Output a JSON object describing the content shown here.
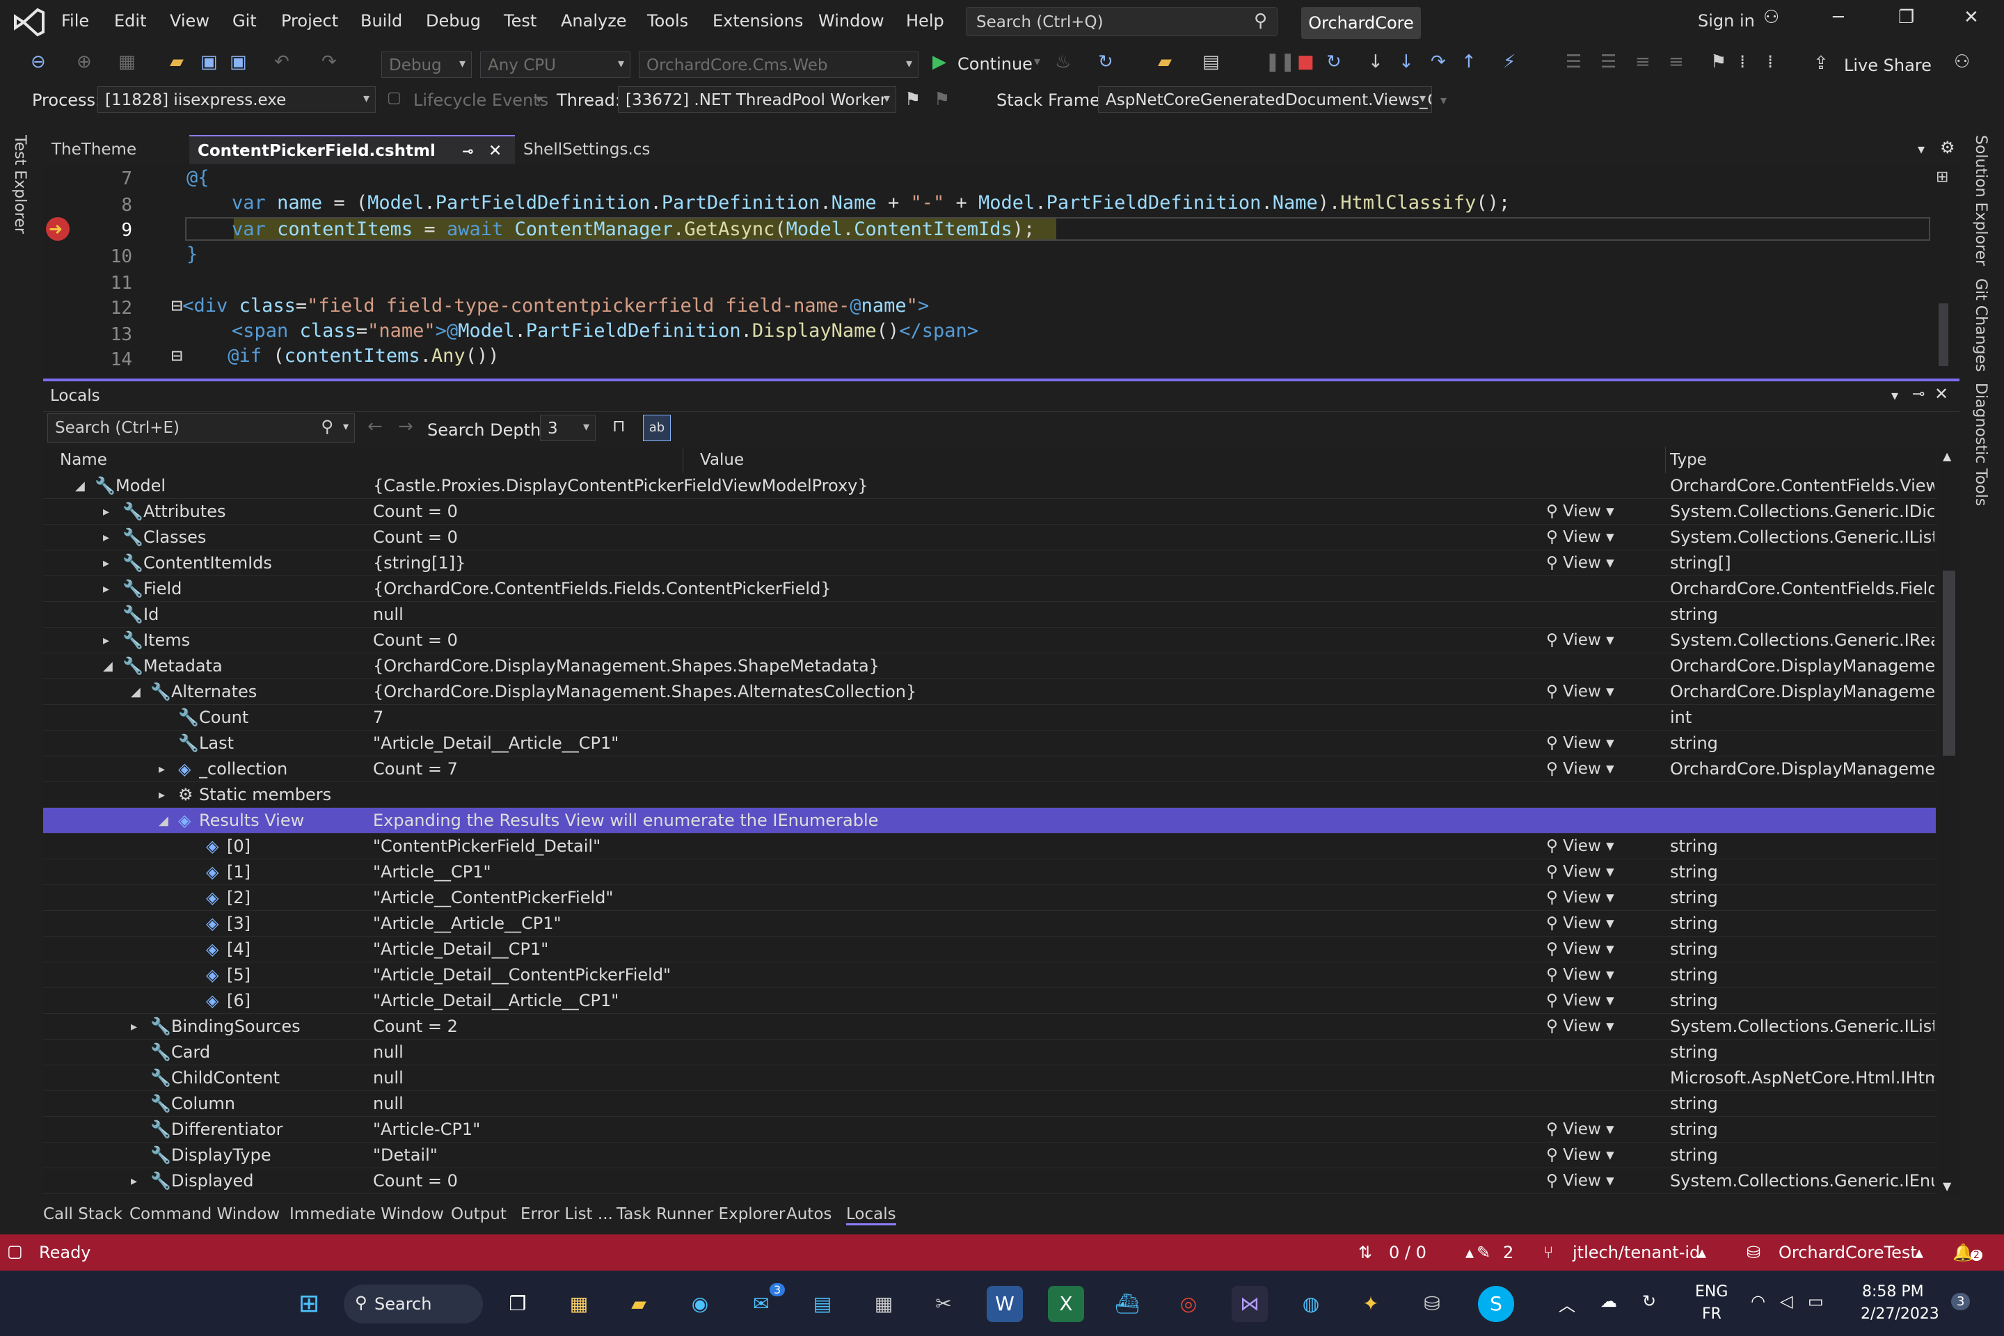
{
  "menu": {
    "items": [
      "File",
      "Edit",
      "View",
      "Git",
      "Project",
      "Build",
      "Debug",
      "Test",
      "Analyze",
      "Tools",
      "Extensions",
      "Window",
      "Help"
    ],
    "search_placeholder": "Search (Ctrl+Q)",
    "solution": "OrchardCore",
    "signin": "Sign in"
  },
  "toolbar": {
    "config": "Debug",
    "platform": "Any CPU",
    "startup": "OrchardCore.Cms.Web",
    "continue": "Continue",
    "live_share": "Live Share"
  },
  "debugbar": {
    "process_label": "Process:",
    "process": "[11828] iisexpress.exe",
    "lifecycle": "Lifecycle Events",
    "thread_label": "Thread:",
    "thread": "[33672] .NET ThreadPool Worker",
    "stackframe_label": "Stack Frame:",
    "stackframe": "AspNetCoreGeneratedDocument.Views_C"
  },
  "side": {
    "left": "Test Explorer",
    "right1": "Solution Explorer",
    "right2": "Git Changes",
    "right3": "Diagnostic Tools"
  },
  "tabs": [
    "TheTheme",
    "ContentPickerField.cshtml",
    "ShellSettings.cs"
  ],
  "editor": {
    "lines": [
      "7",
      "8",
      "9",
      "10",
      "11",
      "12",
      "13",
      "14"
    ]
  },
  "locals": {
    "title": "Locals",
    "search": "Search (Ctrl+E)",
    "depth_label": "Search Depth:",
    "depth": "3",
    "col_name": "Name",
    "col_value": "Value",
    "col_type": "Type",
    "view": "View",
    "rows": [
      {
        "name": "Model",
        "value": "{Castle.Proxies.DisplayContentPickerFieldViewModelProxy}",
        "type": "OrchardCore.ContentFields.ViewMod..."
      },
      {
        "name": "Attributes",
        "value": "Count = 0",
        "type": "System.Collections.Generic.IDictionar..."
      },
      {
        "name": "Classes",
        "value": "Count = 0",
        "type": "System.Collections.Generic.IList<strin..."
      },
      {
        "name": "ContentItemIds",
        "value": "{string[1]}",
        "type": "string[]"
      },
      {
        "name": "Field",
        "value": "{OrchardCore.ContentFields.Fields.ContentPickerField}",
        "type": "OrchardCore.ContentFields.Fields.Co..."
      },
      {
        "name": "Id",
        "value": "null",
        "type": "string"
      },
      {
        "name": "Items",
        "value": "Count = 0",
        "type": "System.Collections.Generic.IReadOnl..."
      },
      {
        "name": "Metadata",
        "value": "{OrchardCore.DisplayManagement.Shapes.ShapeMetadata}",
        "type": "OrchardCore.DisplayManagement.Sh..."
      },
      {
        "name": "Alternates",
        "value": "{OrchardCore.DisplayManagement.Shapes.AlternatesCollection}",
        "type": "OrchardCore.DisplayManagement.Sh..."
      },
      {
        "name": "Count",
        "value": "7",
        "type": "int"
      },
      {
        "name": "Last",
        "value": "\"Article_Detail__Article__CP1\"",
        "type": "string"
      },
      {
        "name": "_collection",
        "value": "Count = 7",
        "type": "OrchardCore.DisplayManagement.Sh..."
      },
      {
        "name": "Static members",
        "value": "",
        "type": ""
      },
      {
        "name": "Results View",
        "value": "Expanding the Results View will enumerate the IEnumerable",
        "type": ""
      },
      {
        "name": "[0]",
        "value": "\"ContentPickerField_Detail\"",
        "type": "string"
      },
      {
        "name": "[1]",
        "value": "\"Article__CP1\"",
        "type": "string"
      },
      {
        "name": "[2]",
        "value": "\"Article__ContentPickerField\"",
        "type": "string"
      },
      {
        "name": "[3]",
        "value": "\"Article__Article__CP1\"",
        "type": "string"
      },
      {
        "name": "[4]",
        "value": "\"Article_Detail__CP1\"",
        "type": "string"
      },
      {
        "name": "[5]",
        "value": "\"Article_Detail__ContentPickerField\"",
        "type": "string"
      },
      {
        "name": "[6]",
        "value": "\"Article_Detail__Article__CP1\"",
        "type": "string"
      },
      {
        "name": "BindingSources",
        "value": "Count = 2",
        "type": "System.Collections.Generic.IList<strin..."
      },
      {
        "name": "Card",
        "value": "null",
        "type": "string"
      },
      {
        "name": "ChildContent",
        "value": "null",
        "type": "Microsoft.AspNetCore.Html.IHtmlCo..."
      },
      {
        "name": "Column",
        "value": "null",
        "type": "string"
      },
      {
        "name": "Differentiator",
        "value": "\"Article-CP1\"",
        "type": "string"
      },
      {
        "name": "DisplayType",
        "value": "\"Detail\"",
        "type": "string"
      },
      {
        "name": "Displayed",
        "value": "Count = 0",
        "type": "System.Collections.Generic.IEnumera..."
      }
    ]
  },
  "bottomtabs": [
    "Call Stack",
    "Command Window",
    "Immediate Window",
    "Output",
    "Error List ...",
    "Task Runner Explorer",
    "Autos",
    "Locals"
  ],
  "status": {
    "ready": "Ready",
    "changes": "0 / 0",
    "edits": "2",
    "branch": "jtlech/tenant-id",
    "repo": "OrchardCoreTest",
    "notif": "2"
  },
  "taskbar": {
    "search": "Search",
    "mail_badge": "3",
    "lang1": "ENG",
    "lang2": "FR",
    "time": "8:58 PM",
    "date": "2/27/2023",
    "notif": "3"
  }
}
